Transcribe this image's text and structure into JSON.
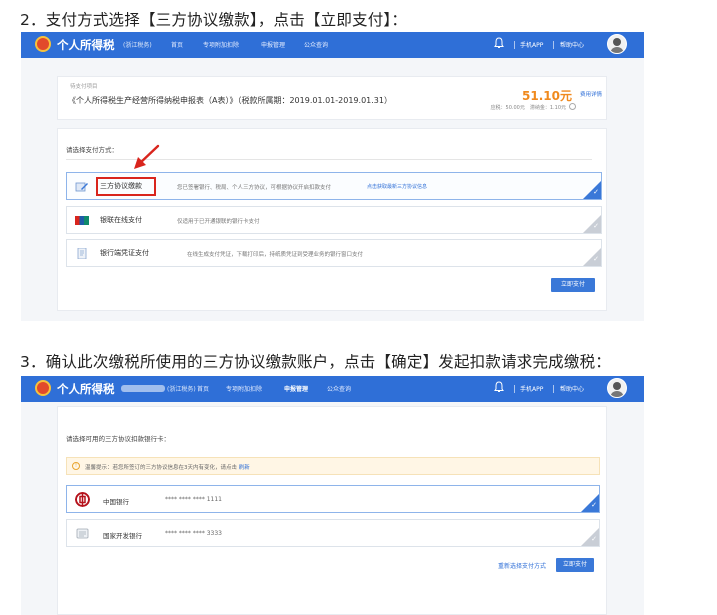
{
  "step2_title": "2．支付方式选择【三方协议缴款】，点击【立即支付】：",
  "step3_title": "3．确认此次缴税所使用的三方协议缴款账户，点击【确定】发起扣款请求完成缴税：",
  "app": {
    "name": "个人所得税",
    "sub_label": "(浙江税务)",
    "nav": [
      "首页",
      "专项附加扣除",
      "申报管理",
      "公众查询"
    ],
    "mobile_app": "手机APP",
    "help_center": "帮助中心",
    "brand_color": "#2f6fd7"
  },
  "pending": {
    "label": "待支付项目",
    "title": "《个人所得税生产经营所得纳税申报表（A表）》（税款所属期：2019.01.01-2019.01.31）",
    "amount": "51.10元",
    "detail_link": "费用详情",
    "breakdown": "应税：50.00元　滞纳金：1.10元"
  },
  "payment": {
    "label": "请选择支付方式：",
    "options": [
      {
        "name": "三方协议缴款",
        "desc": "您已签署银行、税局、个人三方协议，可根据协议开启扣款支付",
        "link": "点击获取最新三方协议信息"
      },
      {
        "name": "银联在线支付",
        "desc": "仅适用于已开通银联的银行卡支付",
        "link": ""
      },
      {
        "name": "银行端凭证支付",
        "desc": "在线生成支付凭证，下载打印后，持纸质凭证到受理业务的银行窗口支付",
        "link": ""
      }
    ],
    "pay_now": "立即支付"
  },
  "bank_select": {
    "label": "请选择可用的三方协议扣款银行卡：",
    "notice": "温馨提示：若您所签订的三方协议信息在3天内有变化，请点击",
    "notice_link": "刷新",
    "banks": [
      {
        "name": "中国银行",
        "account": "**** **** **** 1111"
      },
      {
        "name": "国家开发银行",
        "account": "**** **** **** 3333"
      }
    ],
    "reselect": "重新选择支付方式",
    "pay_now": "立即支付"
  }
}
